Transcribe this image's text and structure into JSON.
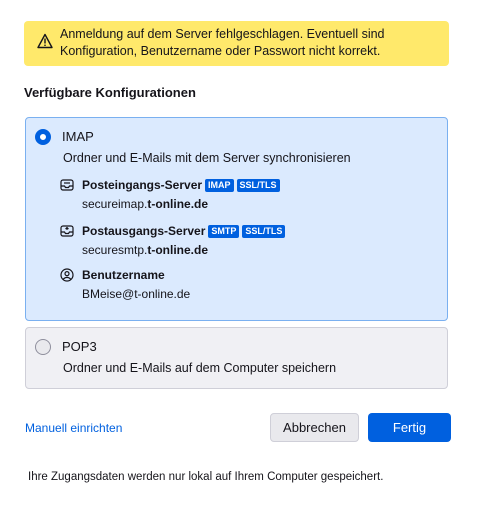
{
  "warning": {
    "icon": "warning-icon",
    "line1": "Anmeldung auf dem Server fehlgeschlagen. Eventuell sind",
    "line2": "Konfiguration, Benutzername oder Passwort nicht korrekt."
  },
  "section_title": "Verfügbare Konfigurationen",
  "options": [
    {
      "title": "IMAP",
      "selected": true,
      "description": "Ordner und E-Mails mit dem Server synchronisieren",
      "details": [
        {
          "icon": "inbox-server-icon",
          "label": "Posteingangs-Server",
          "badges": [
            "IMAP",
            "SSL/TLS"
          ],
          "value_prefix": "secureimap.",
          "value_bold": "t-online.de"
        },
        {
          "icon": "outbox-server-icon",
          "label": "Postausgangs-Server",
          "badges": [
            "SMTP",
            "SSL/TLS"
          ],
          "value_prefix": "securesmtp.",
          "value_bold": "t-online.de"
        },
        {
          "icon": "user-icon",
          "label": "Benutzername",
          "value": "BMeise@t-online.de"
        }
      ]
    },
    {
      "title": "POP3",
      "selected": false,
      "description": "Ordner und E-Mails auf dem Computer speichern"
    }
  ],
  "manual_link": "Manuell einrichten",
  "buttons": {
    "cancel": "Abbrechen",
    "done": "Fertig"
  },
  "footnote": "Ihre Zugangsdaten werden nur lokal auf Ihrem Computer gespeichert.",
  "colors": {
    "accent": "#0060df",
    "warning_bg": "#ffe96b",
    "selected_bg": "#dbeafe"
  }
}
